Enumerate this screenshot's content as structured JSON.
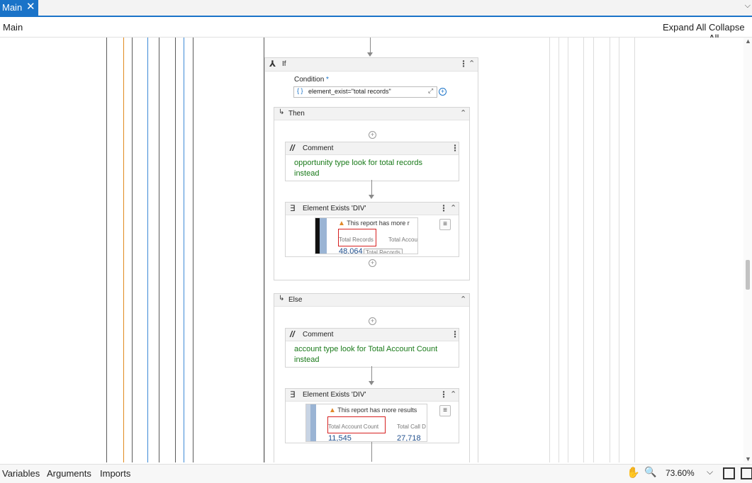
{
  "tabs": {
    "active_label": "Main",
    "close_glyph": "✕",
    "overflow_glyph": "⌵"
  },
  "breadcrumb": {
    "label": "Main",
    "expand_all": "Expand All",
    "collapse_all": "Collapse All"
  },
  "workflow": {
    "if_block": {
      "title": "If",
      "condition_label": "Condition",
      "condition_required": "*",
      "condition_value": "element_exist=\"total records\""
    },
    "then_block": {
      "title": "Then",
      "comment": {
        "title": "Comment",
        "text_line1": "opportunity type look for total records",
        "text_line2": "instead"
      },
      "element_exists": {
        "title": "Element Exists 'DIV'",
        "preview_warning": "This report has more r",
        "preview_label1": "Total Records",
        "preview_label2": "Total Accou",
        "preview_value": "48,064",
        "preview_tooltip": "Total Records"
      }
    },
    "else_block": {
      "title": "Else",
      "comment": {
        "title": "Comment",
        "text_line1": "account type look for Total Account Count",
        "text_line2": "instead"
      },
      "element_exists": {
        "title": "Element Exists 'DIV'",
        "preview_warning": "This report has more results",
        "preview_label1": "Total Account Count",
        "preview_label2": "Total Call D",
        "preview_value1": "11,545",
        "preview_value2": "27,718"
      }
    }
  },
  "bottom": {
    "variables": "Variables",
    "arguments": "Arguments",
    "imports": "Imports",
    "zoom": "73.60%"
  },
  "colors": {
    "accent": "#1a73c8",
    "comment_text": "#1a7a1a",
    "highlight": "#d62020"
  },
  "icons": [
    "close-icon",
    "chevron-down-icon",
    "if-icon",
    "branch-icon",
    "comment-icon",
    "element-exists-icon",
    "kebab-icon",
    "collapse-icon",
    "add-icon",
    "hand-icon",
    "search-icon",
    "fit-screen-icon",
    "fullscreen-icon",
    "hamburger-icon",
    "warning-icon"
  ]
}
